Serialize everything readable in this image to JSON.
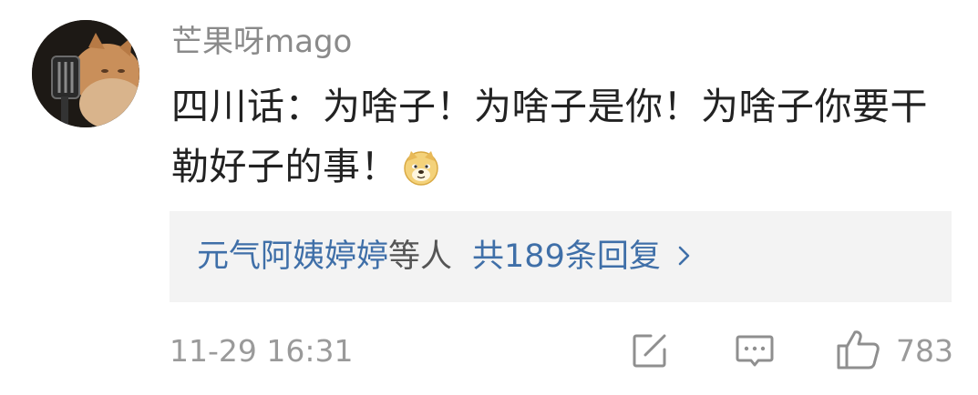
{
  "comment": {
    "username": "芒果呀mago",
    "text": "四川话：为啥子！为啥子是你！为啥子你要干勒好子的事！",
    "emoji_icon": "doge-emoji-icon"
  },
  "replies": {
    "names": "元气阿姨婷婷",
    "suffix": "等人",
    "count_text": "共189条回复"
  },
  "footer": {
    "timestamp": "11-29 16:31",
    "like_count": "783"
  },
  "icons": {
    "edit": "edit-icon",
    "reply": "comment-icon",
    "like": "thumbs-up-icon",
    "more": "chevron-right-icon"
  },
  "colors": {
    "link": "#3f6fa8",
    "muted": "#9a9a9a",
    "reply_bg": "#f3f3f3"
  }
}
